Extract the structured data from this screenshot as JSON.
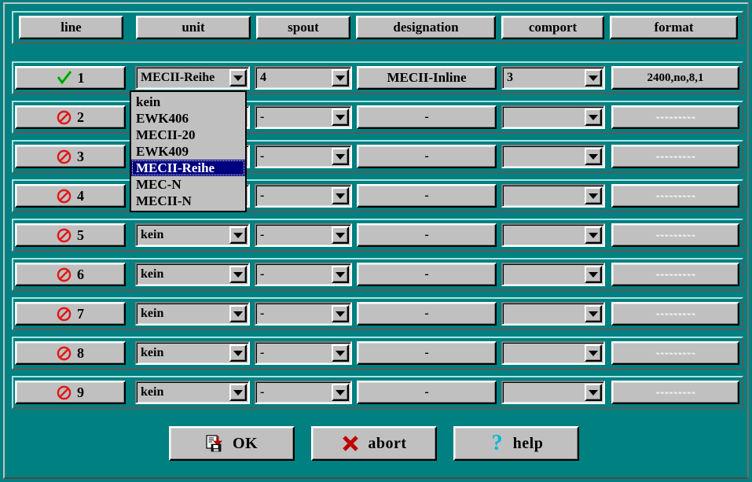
{
  "window": {
    "background_color": "#008080",
    "face_color": "#c0c0c0",
    "highlight_color": "#000080"
  },
  "header": {
    "columns": [
      {
        "key": "line",
        "label": "line"
      },
      {
        "key": "unit",
        "label": "unit"
      },
      {
        "key": "spout",
        "label": "spout"
      },
      {
        "key": "designation",
        "label": "designation"
      },
      {
        "key": "comport",
        "label": "comport"
      },
      {
        "key": "format",
        "label": "format"
      }
    ]
  },
  "rows": [
    {
      "line": "1",
      "status_icon": "check-icon",
      "enabled": true,
      "unit": "MECII-Reihe",
      "spout": "4",
      "designation": "MECII-Inline",
      "comport": "3",
      "format": "2400,no,8,1"
    },
    {
      "line": "2",
      "status_icon": "prohibited-icon",
      "enabled": false,
      "unit": "kein",
      "spout": "-",
      "designation": "-",
      "comport": "",
      "format": "---------"
    },
    {
      "line": "3",
      "status_icon": "prohibited-icon",
      "enabled": false,
      "unit": "kein",
      "spout": "-",
      "designation": "-",
      "comport": "",
      "format": "---------"
    },
    {
      "line": "4",
      "status_icon": "prohibited-icon",
      "enabled": false,
      "unit": "kein",
      "spout": "-",
      "designation": "-",
      "comport": "",
      "format": "---------"
    },
    {
      "line": "5",
      "status_icon": "prohibited-icon",
      "enabled": false,
      "unit": "kein",
      "spout": "-",
      "designation": "-",
      "comport": "",
      "format": "---------"
    },
    {
      "line": "6",
      "status_icon": "prohibited-icon",
      "enabled": false,
      "unit": "kein",
      "spout": "-",
      "designation": "-",
      "comport": "",
      "format": "---------"
    },
    {
      "line": "7",
      "status_icon": "prohibited-icon",
      "enabled": false,
      "unit": "kein",
      "spout": "-",
      "designation": "-",
      "comport": "",
      "format": "---------"
    },
    {
      "line": "8",
      "status_icon": "prohibited-icon",
      "enabled": false,
      "unit": "kein",
      "spout": "-",
      "designation": "-",
      "comport": "",
      "format": "---------"
    },
    {
      "line": "9",
      "status_icon": "prohibited-icon",
      "enabled": false,
      "unit": "kein",
      "spout": "-",
      "designation": "-",
      "comport": "",
      "format": "---------"
    }
  ],
  "unit_dropdown": {
    "open": true,
    "owner_row": "1",
    "selected": "MECII-Reihe",
    "options": [
      "kein",
      "EWK406",
      "MECII-20",
      "EWK409",
      "MECII-Reihe",
      "MEC-N",
      "MECII-N"
    ]
  },
  "actions": [
    {
      "key": "ok",
      "label": "OK",
      "icon": "save-document-icon"
    },
    {
      "key": "abort",
      "label": "abort",
      "icon": "cross-icon"
    },
    {
      "key": "help",
      "label": "help",
      "icon": "question-mark-icon"
    }
  ]
}
